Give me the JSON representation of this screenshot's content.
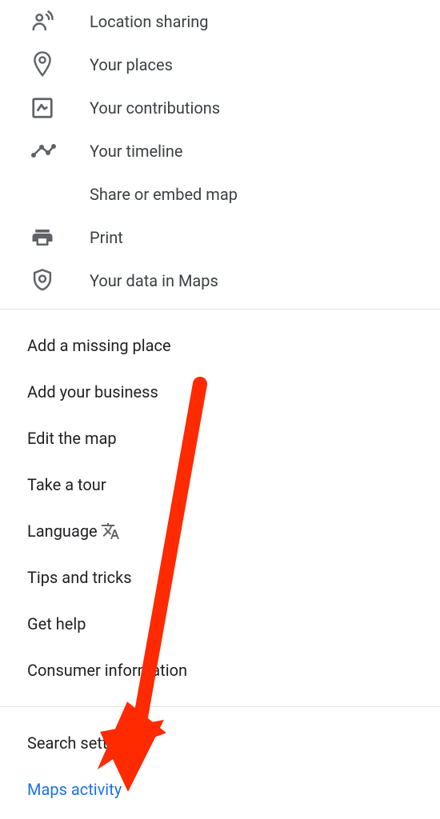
{
  "menu": {
    "top": [
      {
        "icon": "location-sharing-icon",
        "label": "Location sharing"
      },
      {
        "icon": "place-pin-icon",
        "label": "Your places"
      },
      {
        "icon": "contributions-icon",
        "label": "Your contributions"
      },
      {
        "icon": "timeline-icon",
        "label": "Your timeline"
      },
      {
        "icon": "",
        "label": "Share or embed map"
      },
      {
        "icon": "print-icon",
        "label": "Print"
      },
      {
        "icon": "privacy-shield-icon",
        "label": "Your data in Maps"
      }
    ],
    "middle": [
      {
        "label": "Add a missing place"
      },
      {
        "label": "Add your business"
      },
      {
        "label": "Edit the map"
      },
      {
        "label": "Take a tour"
      },
      {
        "label": "Language",
        "trailing_icon": "translate-icon"
      },
      {
        "label": "Tips and tricks"
      },
      {
        "label": "Get help"
      },
      {
        "label": "Consumer information"
      }
    ],
    "bottom": [
      {
        "label": "Search settings"
      },
      {
        "label": "Maps activity",
        "link": true
      }
    ]
  }
}
